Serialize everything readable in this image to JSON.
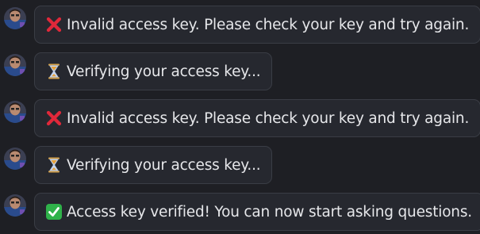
{
  "messages": [
    {
      "status": "error",
      "icon": "cross-mark-icon",
      "text": "Invalid access key. Please check your key and try again."
    },
    {
      "status": "pending",
      "icon": "hourglass-icon",
      "text": "Verifying your access key..."
    },
    {
      "status": "error",
      "icon": "cross-mark-icon",
      "text": "Invalid access key. Please check your key and try again."
    },
    {
      "status": "pending",
      "icon": "hourglass-icon",
      "text": "Verifying your access key..."
    },
    {
      "status": "success",
      "icon": "check-mark-icon",
      "text": "Access key verified! You can now start asking questions."
    }
  ],
  "colors": {
    "background": "#1e1f24",
    "bubble": "#26282f",
    "bubble_border": "#3a3d45",
    "text": "#e6e7ea",
    "error": "#e0283a",
    "success": "#2fb24a",
    "hourglass_frame": "#c8d8f0",
    "hourglass_sand": "#e8a23a"
  }
}
